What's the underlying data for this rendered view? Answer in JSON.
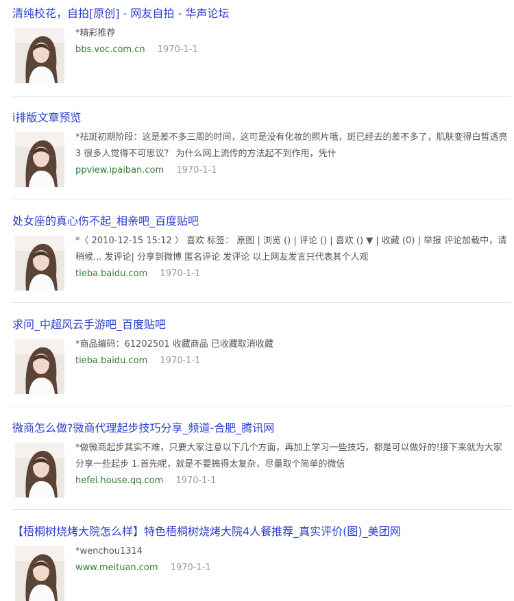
{
  "results": [
    {
      "title": "清纯校花，自拍[原创] - 网友自拍 - 华声论坛",
      "desc": "*精彩推荐",
      "url": "bbs.voc.com.cn",
      "date": "1970-1-1"
    },
    {
      "title": "i排版文章预览",
      "desc": "*祛斑初期阶段：这是差不多三周的时间，这可是没有化妆的照片哦，斑已经去的差不多了，肌肤变得白皙透亮 3 很多人觉得不可思议？ 为什么网上流传的方法起不到作用，凭什",
      "url": "ppview.ipaiban.com",
      "date": "1970-1-1"
    },
    {
      "title": "处女座的真心伤不起_相亲吧_百度贴吧",
      "desc": "*〈 2010-12-15 15:12 〉 喜欢 标签： 原图 | 浏览 () | 评论 () | 喜欢 () ▼ | 收藏 (0) | 举报 评论加载中，请稍候... 发评论| 分享到微博 匿名评论 发评论 以上网友发言只代表其个人观",
      "url": "tieba.baidu.com",
      "date": "1970-1-1"
    },
    {
      "title": "求问_中超风云手游吧_百度贴吧",
      "desc": "*商品编码：61202501 收藏商品 已收藏取消收藏",
      "url": "tieba.baidu.com",
      "date": "1970-1-1"
    },
    {
      "title": "微商怎么做?微商代理起步技巧分享_频道-合肥_腾讯网",
      "desc": "*做微商起步其实不难，只要大家注意以下几个方面，再加上学习一些技巧，都是可以做好的!接下来就为大家分享一些起步 1.首先呢，就是不要搞得太复杂，尽量取个简单的微信",
      "url": "hefei.house.qq.com",
      "date": "1970-1-1"
    },
    {
      "title": "【梧桐树烧烤大院怎么样】特色梧桐树烧烤大院4人餐推荐_真实评价(图)_美团网",
      "desc": "*wenchou1314",
      "url": "www.meituan.com",
      "date": "1970-1-1"
    }
  ],
  "colors": {
    "title": "#2a3ecb",
    "url": "#2e7d32",
    "date": "#9a9a9a",
    "desc": "#555555"
  },
  "icons": {
    "thumbnail": "portrait-photo-thumbnail"
  }
}
